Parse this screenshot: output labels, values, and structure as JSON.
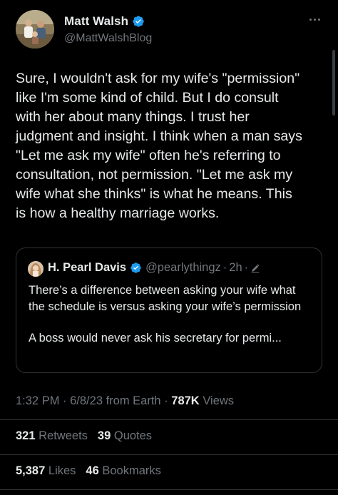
{
  "author": {
    "display_name": "Matt Walsh",
    "handle": "@MattWalshBlog",
    "verified": true,
    "avatar_icon": "profile-photo-avatar"
  },
  "tweet": {
    "text": "Sure, I wouldn't ask for my wife's \"permission\"\nlike I'm some kind of child. But I do consult\nwith her about many things. I trust her\njudgment and insight. I think when a man says\n\"Let me ask my wife\" often he's referring to\nconsultation, not permission. \"Let me ask my\nwife what she thinks\" is what he means. This\nis how a healthy marriage works."
  },
  "quoted_tweet": {
    "display_name": "H. Pearl Davis",
    "handle": "@pearlythingz",
    "separator": "·",
    "time": "2h",
    "separator_2": "·",
    "edited_icon": "pencil-icon",
    "paragraph_1": "There’s a difference between asking your wife what the schedule is versus asking your wife’s permission",
    "paragraph_2": "A boss would never ask his secretary for permi..."
  },
  "meta": {
    "time": "1:32 PM",
    "sep1": " · ",
    "date": "6/8/23",
    "source": " from Earth",
    "sep2": " · ",
    "views_count": "787K",
    "views_label": " Views"
  },
  "stats_row_1": [
    {
      "count": "321",
      "label": "Retweets"
    },
    {
      "count": "39",
      "label": "Quotes"
    }
  ],
  "stats_row_2": [
    {
      "count": "5,387",
      "label": "Likes"
    },
    {
      "count": "46",
      "label": "Bookmarks"
    }
  ],
  "colors": {
    "background": "#000000",
    "text_primary": "#e7e9ea",
    "text_secondary": "#71767b",
    "verified_blue": "#1d9bf0",
    "border": "#2f3336"
  }
}
